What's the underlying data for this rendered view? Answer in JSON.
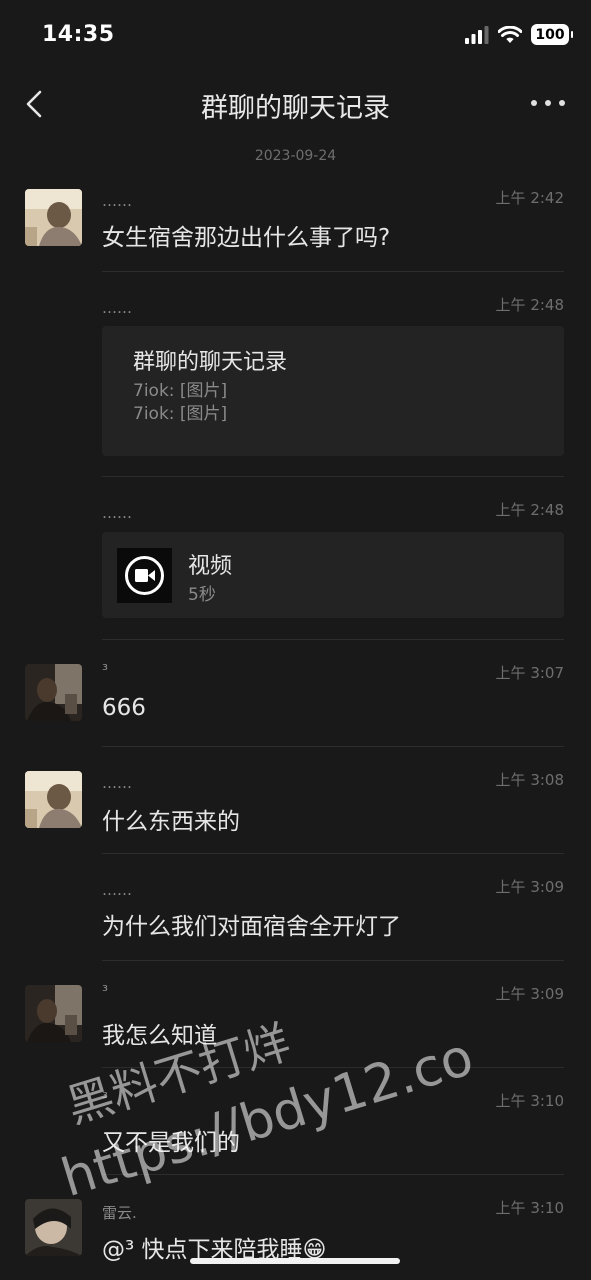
{
  "status_bar": {
    "time": "14:35",
    "battery": "100"
  },
  "nav": {
    "title": "群聊的聊天记录"
  },
  "date": "2023-09-24",
  "messages": [
    {
      "sender": "……",
      "time": "上午 2:42",
      "text": "女生宿舍那边出什么事了吗?",
      "avatar": "avatar-a"
    },
    {
      "sender": "……",
      "time": "上午 2:48",
      "card": {
        "title": "群聊的聊天记录",
        "lines": [
          "7iok: [图片]",
          "7iok: [图片]"
        ]
      }
    },
    {
      "sender": "……",
      "time": "上午 2:48",
      "video": {
        "title": "视频",
        "duration": "5秒"
      }
    },
    {
      "sender": "³",
      "time": "上午 3:07",
      "text": "666",
      "avatar": "avatar-b"
    },
    {
      "sender": "……",
      "time": "上午 3:08",
      "text": "什么东西来的",
      "avatar": "avatar-a"
    },
    {
      "sender": "……",
      "time": "上午 3:09",
      "text": "为什么我们对面宿舍全开灯了"
    },
    {
      "sender": "³",
      "time": "上午 3:09",
      "text": "我怎么知道",
      "avatar": "avatar-b"
    },
    {
      "sender": "³",
      "time": "上午 3:10",
      "text": "又不是我们的"
    },
    {
      "sender": "雷云.",
      "time": "上午 3:10",
      "text": "@³ 快点下来陪我睡😁",
      "avatar": "avatar-c"
    }
  ],
  "watermark": {
    "line1": "黑料不打烊",
    "line2": "https://bdy12.co"
  },
  "colors": {
    "background": "#191919",
    "card": "#232323",
    "text": "#e6e6e6",
    "muted": "#8a8a8a"
  }
}
